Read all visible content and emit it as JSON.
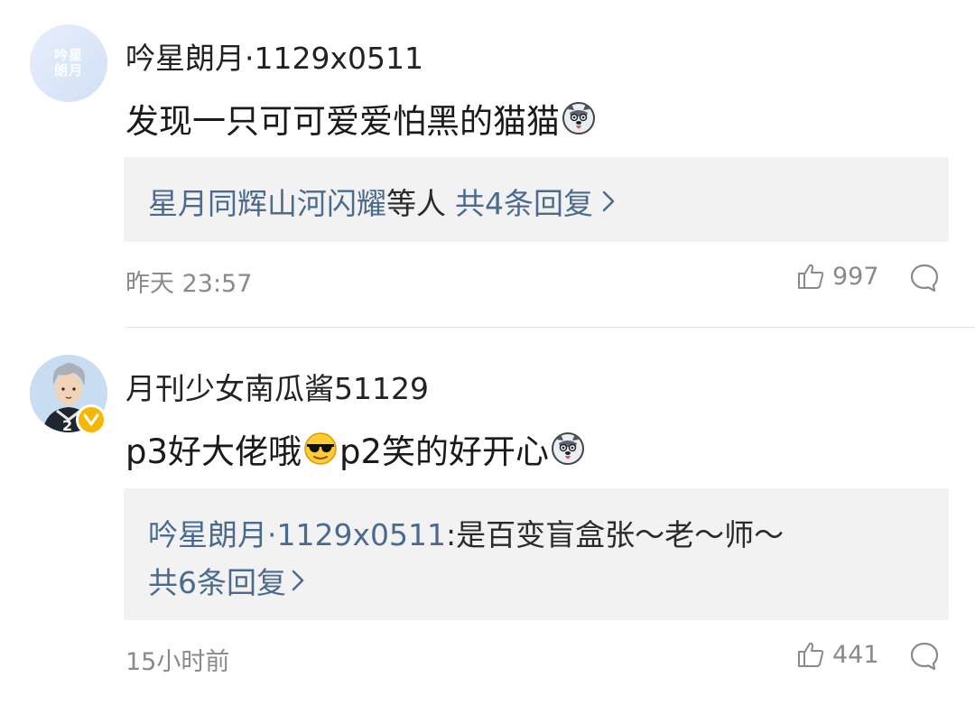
{
  "comments": [
    {
      "avatar_text": [
        "吟星",
        "朗月"
      ],
      "username": "吟星朗月·1129x0511",
      "content_text": "发现一只可可爱爱怕黑的猫猫",
      "content_emoji": "husky-emoji",
      "replies_summary": {
        "names": "星月同辉山河闪耀",
        "suffix": "等人",
        "count_text": "共4条回复"
      },
      "time": "昨天 23:57",
      "likes": "997"
    },
    {
      "username": "月刊少女南瓜酱51129",
      "verified": true,
      "avatar_jersey": "2",
      "content_parts": [
        "p3好大佬哦",
        "sunglasses-emoji",
        "p2笑的好开心",
        "husky-emoji"
      ],
      "content_a": "p3好大佬哦",
      "content_b": "p2笑的好开心",
      "reply_preview": {
        "author": "吟星朗月·1129x0511",
        "text": ":是百变盲盒张～老～师～",
        "count_text": "共6条回复"
      },
      "time": "15小时前",
      "likes": "441"
    }
  ],
  "colors": {
    "link": "#4a6b8f",
    "meta": "#8a8a8a",
    "reply_bg": "#f2f2f2",
    "verified_badge": "#f5b800"
  },
  "icons": [
    "thumbs-up-icon",
    "comment-bubble-icon",
    "chevron-right-icon"
  ]
}
